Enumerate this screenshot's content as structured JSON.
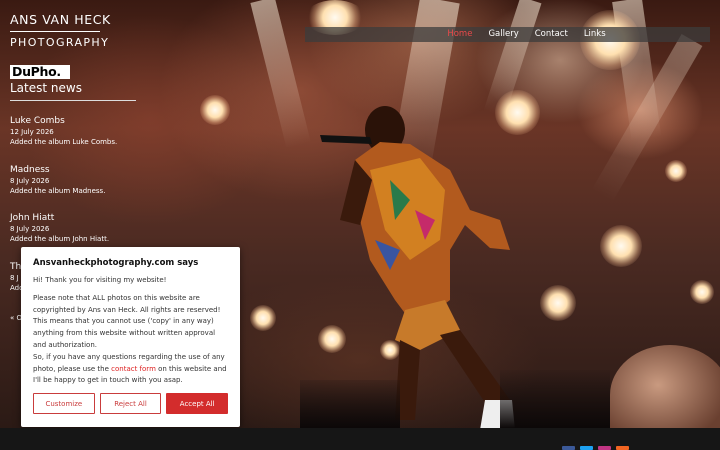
{
  "logo": {
    "line1": "ANS VAN HECK",
    "line2": "PHOTOGRAPHY"
  },
  "nav": [
    {
      "label": "Home",
      "active": true
    },
    {
      "label": "Gallery",
      "active": false
    },
    {
      "label": "Contact",
      "active": false
    },
    {
      "label": "Links",
      "active": false
    }
  ],
  "badge": {
    "text": "DuPho."
  },
  "news": {
    "title": "Latest news",
    "items": [
      {
        "title": "Luke Combs",
        "date": "12 July 2026",
        "summary": "Added the album Luke Combs."
      },
      {
        "title": "Madness",
        "date": "8 July 2026",
        "summary": "Added the album Madness."
      },
      {
        "title": "John Hiatt",
        "date": "8 July 2026",
        "summary": "Added the album John Hiatt."
      },
      {
        "title": "Th",
        "date": "8 J",
        "summary": "Add"
      }
    ],
    "older_link": "« O"
  },
  "dialog": {
    "title": "Ansvanheckphotography.com says",
    "greeting": "Hi! Thank you for visiting my website!",
    "body": "Please note that ALL photos on this website are copyrighted by Ans van Heck. All rights are reserved! This means that you cannot use ('copy' in any way) anything from this website without written approval and authorization.",
    "questions_before": "So, if you have any questions regarding the use of any photo, please use the ",
    "questions_link": "contact form",
    "questions_after": " on this website and I'll be happy to get in touch with you asap.",
    "buttons": {
      "customize": "Customize",
      "reject": "Reject All",
      "accept": "Accept All"
    }
  },
  "colors": {
    "accent": "#d32c2c",
    "nav_active": "#e84a4a",
    "footer_bg": "#161616"
  }
}
